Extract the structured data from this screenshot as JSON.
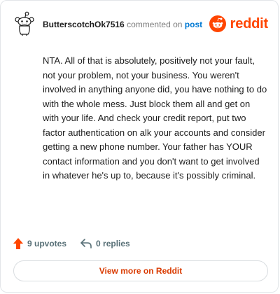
{
  "comment": {
    "username": "ButterscotchOk7516",
    "action_text": "commented on",
    "post_link_text": "post",
    "body": "NTA. All of that is absolutely, positively not your fault, not your problem, not your business. You weren't involved in anything anyone did, you have nothing to do with the whole mess. Just block them all and get on with your life. And check your credit report, put two factor authentication on alk your accounts and consider getting a new phone number. Your father has YOUR contact information and you don't want to get involved in whatever he's up to, because it's possibly criminal.",
    "upvotes_label": "9 upvotes",
    "replies_label": "0 replies"
  },
  "brand": {
    "wordmark": "reddit",
    "color": "#ff4500"
  },
  "view_more_label": "View more on Reddit",
  "icons": {
    "avatar": "snoo-avatar-icon",
    "upvote": "upvote-arrow-icon",
    "reply": "reply-arrow-icon",
    "logo": "reddit-logo-icon"
  }
}
